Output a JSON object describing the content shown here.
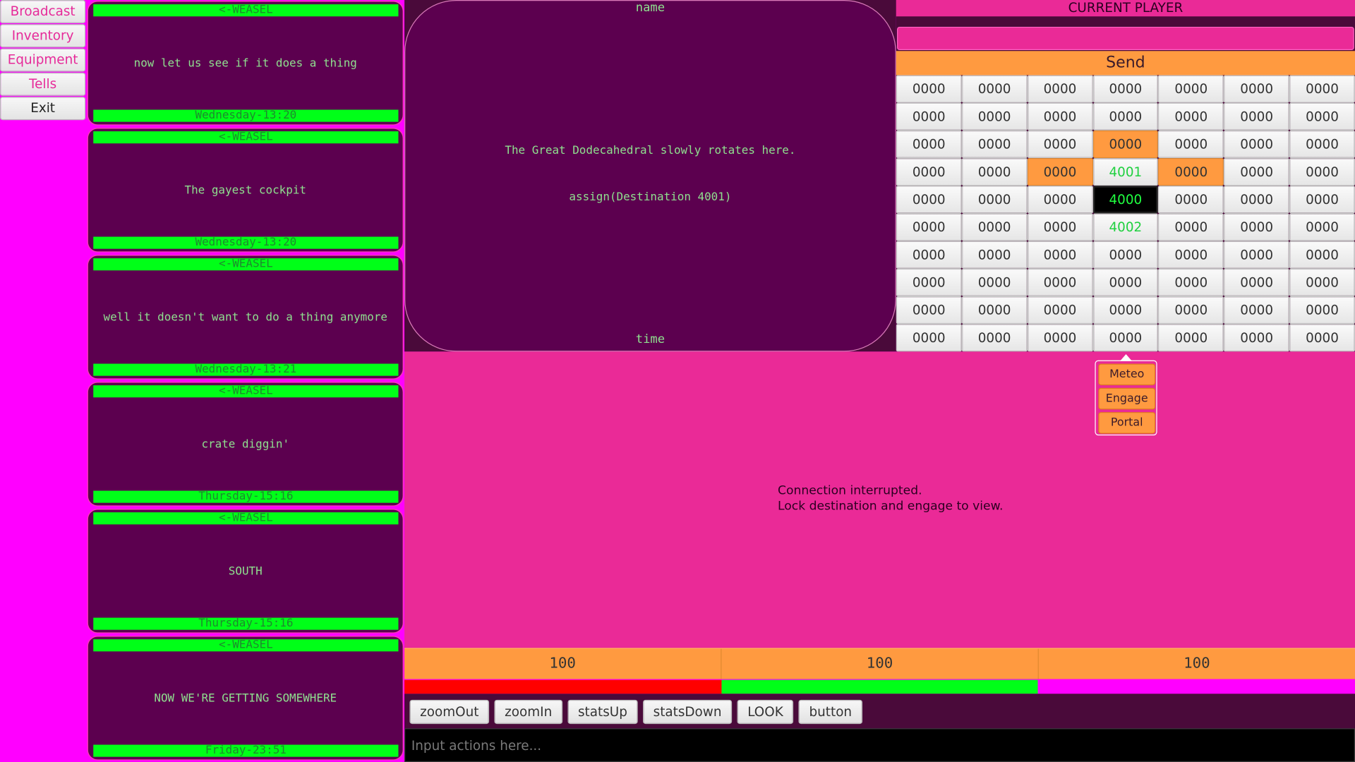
{
  "menu": {
    "items": [
      {
        "label": "Broadcast"
      },
      {
        "label": "Inventory"
      },
      {
        "label": "Equipment"
      },
      {
        "label": "Tells"
      },
      {
        "label": "Exit"
      }
    ]
  },
  "messages": [
    {
      "from": "<-WEASEL",
      "text": "now let us see if it does a thing",
      "time": "Wednesday-13:20"
    },
    {
      "from": "<-WEASEL",
      "text": "The gayest cockpit",
      "time": "Wednesday-13:20"
    },
    {
      "from": "<-WEASEL",
      "text": "well it doesn't want to do a thing anymore",
      "time": "Wednesday-13:21"
    },
    {
      "from": "<-WEASEL",
      "text": "crate diggin'",
      "time": "Thursday-15:16"
    },
    {
      "from": "<-WEASEL",
      "text": "SOUTH",
      "time": "Thursday-15:16"
    },
    {
      "from": "<-WEASEL",
      "text": "NOW WE'RE GETTING SOMEWHERE",
      "time": "Friday-23:51"
    }
  ],
  "room": {
    "name": "name",
    "description": "The Great Dodecahedral slowly rotates here.",
    "assign": "assign(Destination 4001)",
    "time": "time"
  },
  "player": {
    "title": "CURRENT PLAYER",
    "send_label": "Send"
  },
  "grid": {
    "default_value": "0000",
    "rows": [
      [
        "0000",
        "0000",
        "0000",
        "0000",
        "0000",
        "0000",
        "0000"
      ],
      [
        "0000",
        "0000",
        "0000",
        "0000",
        "0000",
        "0000",
        "0000"
      ],
      [
        "0000",
        "0000",
        "0000",
        "0000",
        "0000",
        "0000",
        "0000"
      ],
      [
        "0000",
        "0000",
        "0000",
        "4001",
        "0000",
        "0000",
        "0000"
      ],
      [
        "0000",
        "0000",
        "0000",
        "4000",
        "0000",
        "0000",
        "0000"
      ],
      [
        "0000",
        "0000",
        "0000",
        "4002",
        "0000",
        "0000",
        "0000"
      ],
      [
        "0000",
        "0000",
        "0000",
        "0000",
        "0000",
        "0000",
        "0000"
      ],
      [
        "0000",
        "0000",
        "0000",
        "0000",
        "0000",
        "0000",
        "0000"
      ],
      [
        "0000",
        "0000",
        "0000",
        "0000",
        "0000",
        "0000",
        "0000"
      ],
      [
        "0000",
        "0000",
        "0000",
        "0000",
        "0000",
        "0000",
        "0000"
      ]
    ],
    "orange_cells": [
      [
        2,
        3
      ],
      [
        3,
        2
      ],
      [
        3,
        4
      ]
    ],
    "green_cells": [
      [
        3,
        3
      ],
      [
        5,
        3
      ]
    ],
    "current_cell": [
      4,
      3
    ]
  },
  "popup": {
    "items": [
      {
        "label": "Meteo"
      },
      {
        "label": "Engage"
      },
      {
        "label": "Portal"
      }
    ]
  },
  "map": {
    "line1": "Connection interrupted.",
    "line2": "Lock destination and engage to view."
  },
  "stats": [
    {
      "value": "100",
      "color": "#ff0000",
      "fraction": 1.0
    },
    {
      "value": "100",
      "color": "#00ff18",
      "fraction": 1.0
    },
    {
      "value": "100",
      "color": "#ff00ff",
      "fraction": 1.0
    }
  ],
  "toolbar": {
    "buttons": [
      {
        "label": "zoomOut"
      },
      {
        "label": "zoomIn"
      },
      {
        "label": "statsUp"
      },
      {
        "label": "statsDown"
      },
      {
        "label": "LOOK"
      },
      {
        "label": "button"
      }
    ]
  },
  "action": {
    "placeholder": "Input actions here..."
  }
}
